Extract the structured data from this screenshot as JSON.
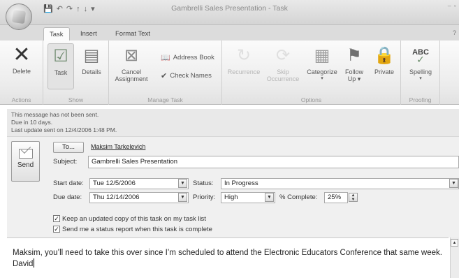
{
  "window": {
    "title": "Gambrelli Sales Presentation - Task"
  },
  "quick_access": {
    "save": "💾",
    "undo": "↶",
    "redo": "↷",
    "up": "↑",
    "down": "↓",
    "more": "▾"
  },
  "tabs": [
    "Task",
    "Insert",
    "Format Text"
  ],
  "ribbon": {
    "delete": "Delete",
    "task": "Task",
    "details": "Details",
    "cancel_assignment_1": "Cancel",
    "cancel_assignment_2": "Assignment",
    "address_book": "Address Book",
    "check_names": "Check Names",
    "recurrence": "Recurrence",
    "skip_occurrence_1": "Skip",
    "skip_occurrence_2": "Occurrence",
    "categorize": "Categorize",
    "follow_up_1": "Follow",
    "follow_up_2": "Up ▾",
    "private": "Private",
    "spelling": "Spelling",
    "groups": {
      "actions": "Actions",
      "show": "Show",
      "manage_task": "Manage Task",
      "options": "Options",
      "proofing": "Proofing"
    }
  },
  "info": {
    "line1": "This message has not been sent.",
    "line2": "Due in 10 days.",
    "line3": "Last update sent on 12/4/2006 1:48 PM."
  },
  "form": {
    "send": "Send",
    "to_button": "To...",
    "to_value": "Maksim Tarkelevich",
    "subject_label": "Subject:",
    "subject_value": "Gambrelli Sales Presentation",
    "start_label": "Start date:",
    "start_value": "Tue 12/5/2006",
    "due_label": "Due date:",
    "due_value": "Thu 12/14/2006",
    "status_label": "Status:",
    "status_value": "In Progress",
    "priority_label": "Priority:",
    "priority_value": "High",
    "complete_label": "% Complete:",
    "complete_value": "25%",
    "keep_copy": "Keep an updated copy of this task on my task list",
    "status_report": "Send me a status report when this task is complete",
    "keep_copy_checked": true,
    "status_report_checked": true
  },
  "body_text": "Maksim, you’ll need to take this over since I’m scheduled to attend the Electronic Educators Conference that same week. David"
}
